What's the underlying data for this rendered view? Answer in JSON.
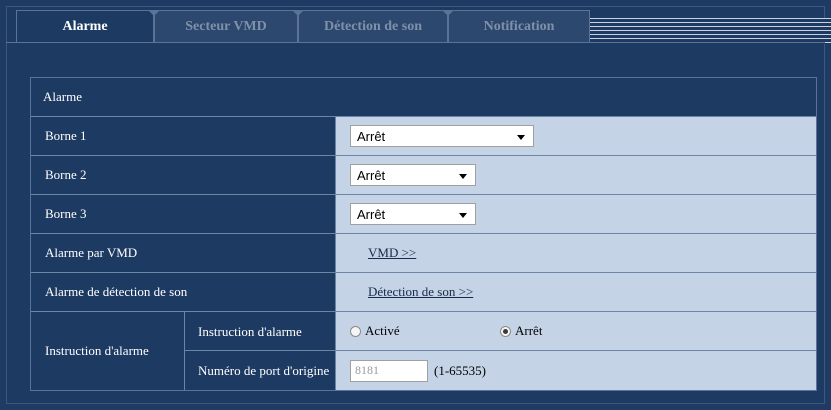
{
  "tabs": [
    {
      "label": "Alarme",
      "active": true
    },
    {
      "label": "Secteur VMD",
      "active": false
    },
    {
      "label": "Détection de son",
      "active": false
    },
    {
      "label": "Notification",
      "active": false
    }
  ],
  "section_title": "Alarme",
  "rows": {
    "borne1": {
      "label": "Borne 1",
      "value": "Arrêt"
    },
    "borne2": {
      "label": "Borne 2",
      "value": "Arrêt"
    },
    "borne3": {
      "label": "Borne 3",
      "value": "Arrêt"
    },
    "vmd": {
      "label": "Alarme par VMD",
      "link": "VMD >>"
    },
    "sound": {
      "label": "Alarme de détection de son",
      "link": "Détection de son >>"
    }
  },
  "instruction": {
    "label": "Instruction d'alarme",
    "sub_label": "Instruction d'alarme",
    "option_on": "Activé",
    "option_off": "Arrêt",
    "selected": "Arrêt",
    "port_label": "Numéro de port d'origine",
    "port_value": "8181",
    "port_range": "(1-65535)"
  },
  "colors": {
    "background": "#1d3a62",
    "value_cell": "#c4d3e6",
    "border": "#6d84a3"
  }
}
